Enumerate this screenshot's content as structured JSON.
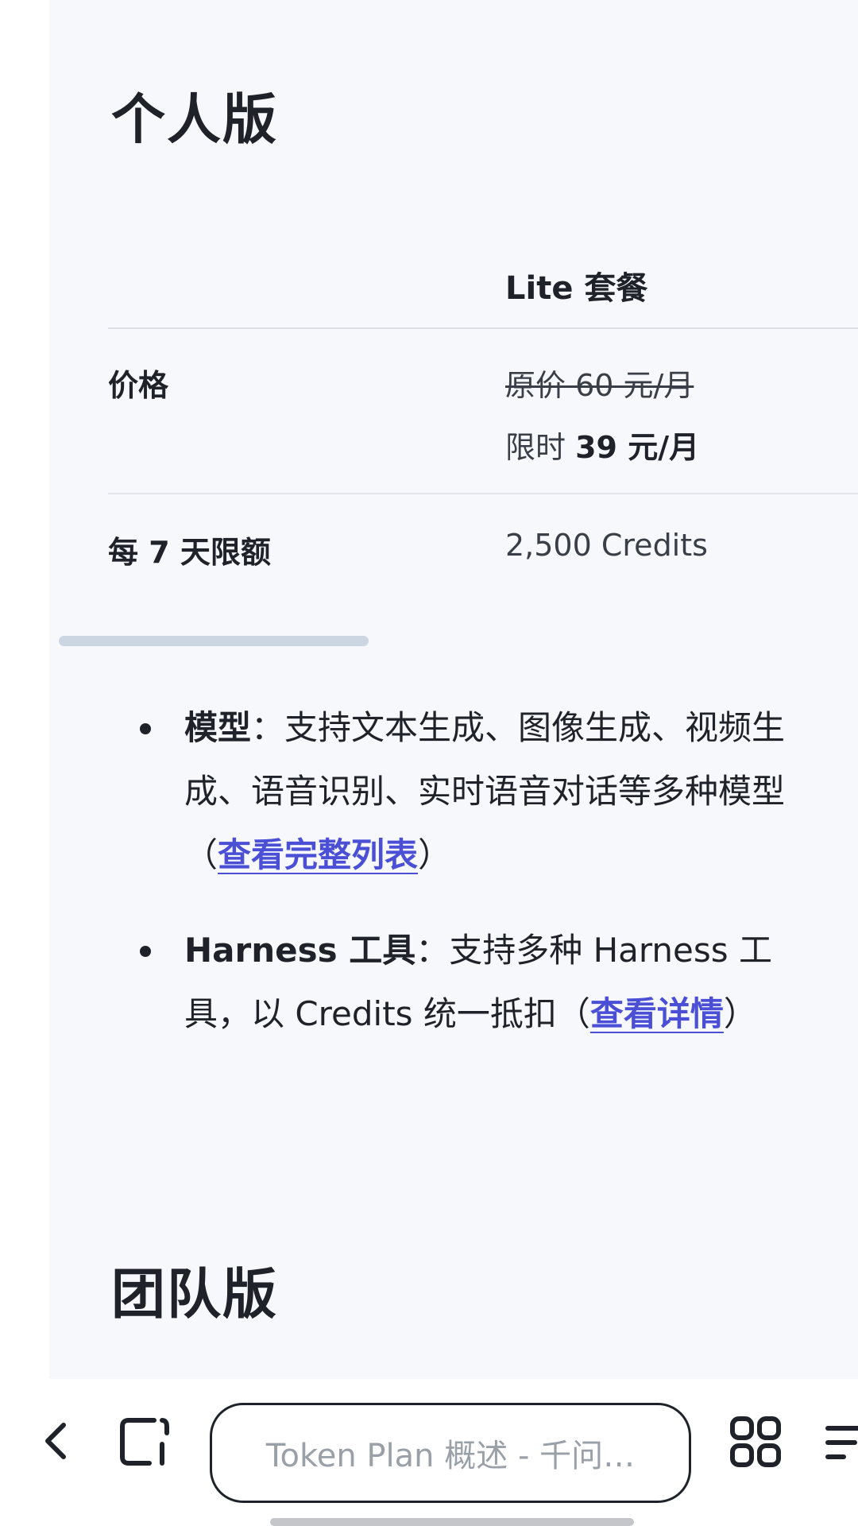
{
  "sections": {
    "personal_title": "个人版",
    "team_title": "团队版"
  },
  "table": {
    "plan_header": "Lite 套餐",
    "price_label": "价格",
    "price_original": "原价 60 元/月",
    "price_sale_prefix": "限时 ",
    "price_sale_value": "39 元/月",
    "quota_label": "每 7 天限额",
    "quota_value": "2,500 Credits"
  },
  "bullets": {
    "models": {
      "strong": "模型",
      "text": "：支持文本生成、图像生成、视频生成、语音识别、实时语音对话等多种模型（",
      "link": "查看完整列表",
      "suffix": "）"
    },
    "harness": {
      "strong": "Harness 工具",
      "text": "：支持多种 Harness 工具，以 Credits 统一抵扣（",
      "link": "查看详情",
      "suffix": "）"
    }
  },
  "browser_bar": {
    "address_text": "Token Plan 概述 - 千问…",
    "icons": [
      "back-icon",
      "tab-icon",
      "grid-icon",
      "menu-icon"
    ]
  },
  "colors": {
    "panel_background": "#f6f8fc",
    "link": "#4a4fd6",
    "text": "#1f2329",
    "scrollbar": "#ccd6e3"
  }
}
